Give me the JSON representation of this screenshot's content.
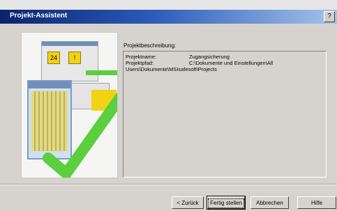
{
  "window": {
    "title": "Projekt-Assistent",
    "help_glyph": "?"
  },
  "image": {
    "icon_labels": [
      "24",
      "!"
    ]
  },
  "description": {
    "heading": "Projektbeschreibung:",
    "rows": [
      {
        "key": "Projektname:",
        "value": "Zugangsicherung"
      },
      {
        "key": "Projektpfad:",
        "value": "C:\\Dokumente und Einstellungen\\All"
      },
      {
        "key": "Users\\Dokumente\\MSIsafesoft\\Projects",
        "value": ""
      }
    ]
  },
  "buttons": {
    "back": "< Zurück",
    "finish": "Fertig stellen",
    "cancel": "Abbrechen",
    "help": "Hilfe"
  },
  "colors": {
    "check_green": "#5ccf3f",
    "title_start": "#0a246a",
    "title_end": "#a6c4ea"
  }
}
